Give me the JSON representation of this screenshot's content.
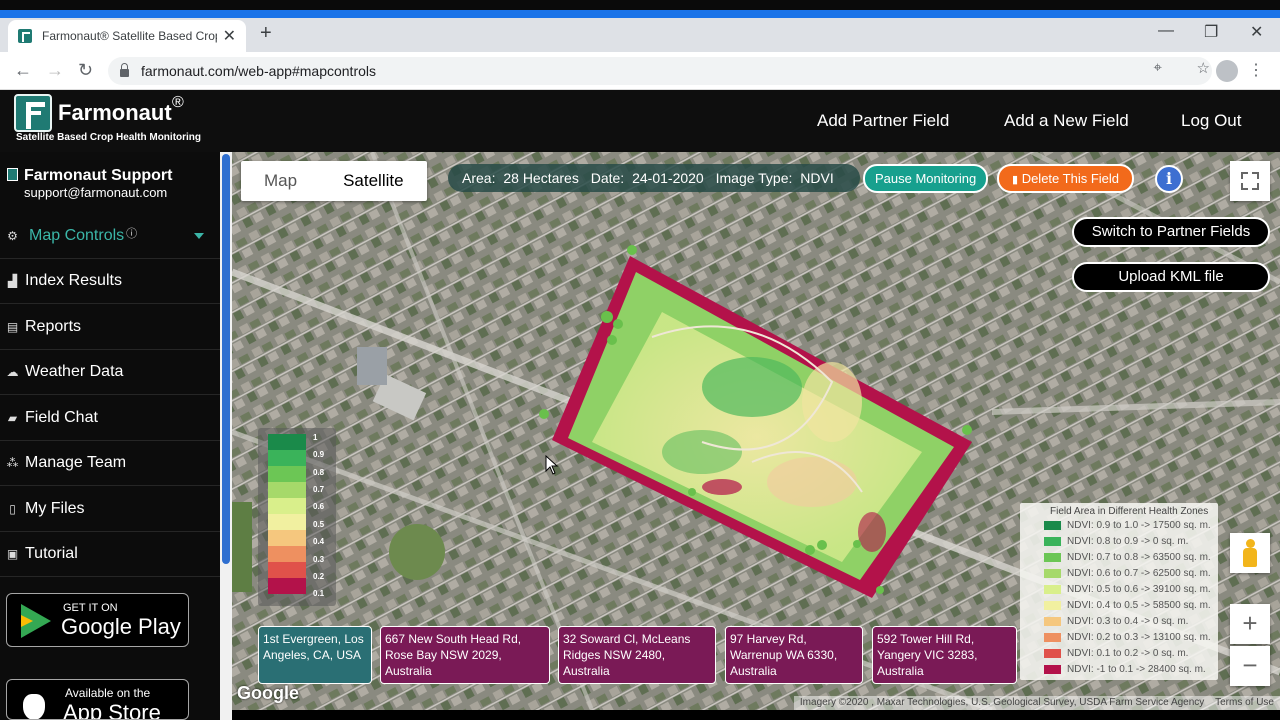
{
  "browser": {
    "tab_title": "Farmonaut® Satellite Based Crop",
    "tab_close": "✕",
    "new_tab": "+",
    "url": "farmonaut.com/web-app#mapcontrols"
  },
  "header": {
    "brand": "Farmonaut",
    "reg": "®",
    "tagline": "Satellite Based Crop Health Monitoring",
    "links": [
      "Add Partner Field",
      "Add a New Field",
      "Log Out"
    ]
  },
  "sidebar": {
    "support_name": "Farmonaut Support",
    "support_email": "support@farmonaut.com",
    "items": [
      {
        "label": "Map Controls",
        "icon": "gear-icon"
      },
      {
        "label": "Index Results",
        "icon": "chart-icon"
      },
      {
        "label": "Reports",
        "icon": "document-icon"
      },
      {
        "label": "Weather Data",
        "icon": "cloud-icon"
      },
      {
        "label": "Field Chat",
        "icon": "chat-icon"
      },
      {
        "label": "Manage Team",
        "icon": "team-icon"
      },
      {
        "label": "My Files",
        "icon": "file-icon"
      },
      {
        "label": "Tutorial",
        "icon": "monitor-icon"
      }
    ],
    "google_play_small": "GET IT ON",
    "google_play_big": "Google Play",
    "app_store_small": "Available on the",
    "app_store_big": "App Store"
  },
  "map": {
    "type_map": "Map",
    "type_satellite": "Satellite",
    "area_label": "Area:",
    "area_value": "28 Hectares",
    "date_label": "Date:",
    "date_value": "24-01-2020",
    "image_type_label": "Image Type:",
    "image_type_value": "NDVI",
    "pause_label": "Pause Monitoring",
    "delete_label": "Delete This Field",
    "info_label": "i",
    "switch_label": "Switch to Partner Fields",
    "upload_label": "Upload KML file",
    "scale_labels": [
      "1",
      "0.9",
      "0.8",
      "0.7",
      "0.6",
      "0.5",
      "0.4",
      "0.3",
      "0.2",
      "0.1"
    ],
    "zoom_in": "+",
    "zoom_out": "−",
    "google": "Google",
    "attribution": "Imagery ©2020 , Maxar Technologies, U.S. Geological Survey, USDA Farm Service Agency",
    "terms": "Terms of Use"
  },
  "addresses": [
    {
      "text": "1st Evergreen, Los Angeles, CA, USA",
      "color": "#2a6f74"
    },
    {
      "text": "667 New South Head Rd, Rose Bay NSW 2029, Australia",
      "color": "#7a1a56"
    },
    {
      "text": "32 Soward Cl, McLeans Ridges NSW 2480, Australia",
      "color": "#7a1a56"
    },
    {
      "text": "97 Harvey Rd, Warrenup WA 6330, Australia",
      "color": "#7a1a56"
    },
    {
      "text": "592 Tower Hill Rd, Yangery VIC 3283, Australia",
      "color": "#7a1a56"
    }
  ],
  "legend": {
    "title": "Field Area in Different Health Zones",
    "rows": [
      {
        "text": "NDVI: 0.9 to 1.0 -> 17500 sq. m.",
        "color": "#1a8a4a"
      },
      {
        "text": "NDVI: 0.8 to 0.9 -> 0 sq. m.",
        "color": "#3ab35a"
      },
      {
        "text": "NDVI: 0.7 to 0.8 -> 63500 sq. m.",
        "color": "#6cc655"
      },
      {
        "text": "NDVI: 0.6 to 0.7 -> 62500 sq. m.",
        "color": "#a6d96a"
      },
      {
        "text": "NDVI: 0.5 to 0.6 -> 39100 sq. m.",
        "color": "#d9ef8b"
      },
      {
        "text": "NDVI: 0.4 to 0.5 -> 58500 sq. m.",
        "color": "#f1f0a0"
      },
      {
        "text": "NDVI: 0.3 to 0.4 -> 0 sq. m.",
        "color": "#f5c77e"
      },
      {
        "text": "NDVI: 0.2 to 0.3 -> 13100 sq. m.",
        "color": "#ee9060"
      },
      {
        "text": "NDVI: 0.1 to 0.2 -> 0 sq. m.",
        "color": "#e0514a"
      },
      {
        "text": "NDVI: -1 to 0.1 -> 28400 sq. m.",
        "color": "#b3124a"
      }
    ]
  }
}
